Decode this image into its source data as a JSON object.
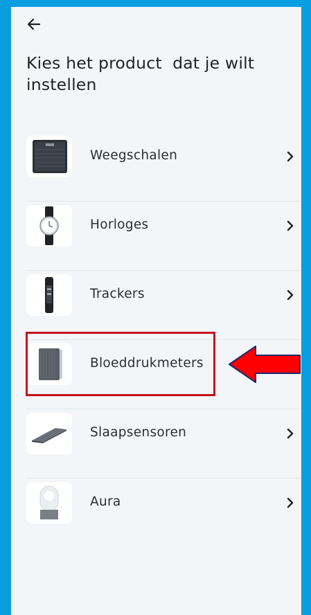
{
  "header": {
    "back_icon": "arrow-left-icon",
    "title": "Kies het product  dat je wilt instellen"
  },
  "products": [
    {
      "label": "Weegschalen",
      "icon": "scale-icon"
    },
    {
      "label": "Horloges",
      "icon": "watch-icon"
    },
    {
      "label": "Trackers",
      "icon": "tracker-icon"
    },
    {
      "label": "Bloeddrukmeters",
      "icon": "blood-pressure-monitor-icon",
      "highlighted": true
    },
    {
      "label": "Slaapsensoren",
      "icon": "sleep-sensor-icon"
    },
    {
      "label": "Aura",
      "icon": "aura-lamp-icon"
    }
  ],
  "annotation": {
    "highlight_color": "#c5101c",
    "arrow_color": "#ff0000",
    "arrow_outline": "#1a2a6c"
  },
  "colors": {
    "frame": "#0a9ee0",
    "background": "#f3f5f8",
    "text": "#1f2226"
  }
}
